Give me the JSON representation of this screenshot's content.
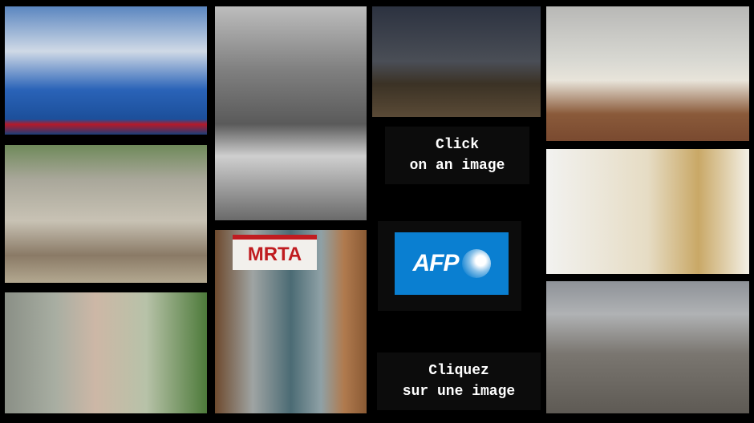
{
  "instructions": {
    "english": [
      "Click",
      "on an image"
    ],
    "french": [
      "Cliquez",
      "sur une image"
    ]
  },
  "logo": {
    "text": "AFP",
    "color": "#0a7fd1"
  },
  "photos": [
    {
      "subject": "swimmer underwater",
      "sign": ""
    },
    {
      "subject": "armed men in street",
      "sign": ""
    },
    {
      "subject": "hands through fence",
      "sign": ""
    },
    {
      "subject": "seated cleric black and white",
      "sign": ""
    },
    {
      "subject": "broken window with banner",
      "sign": "MRTA"
    },
    {
      "subject": "soldiers at night",
      "sign": ""
    },
    {
      "subject": "men in white robes praying",
      "sign": ""
    },
    {
      "subject": "pope with crozier",
      "sign": ""
    },
    {
      "subject": "soldier overlooking ruined city",
      "sign": ""
    }
  ]
}
